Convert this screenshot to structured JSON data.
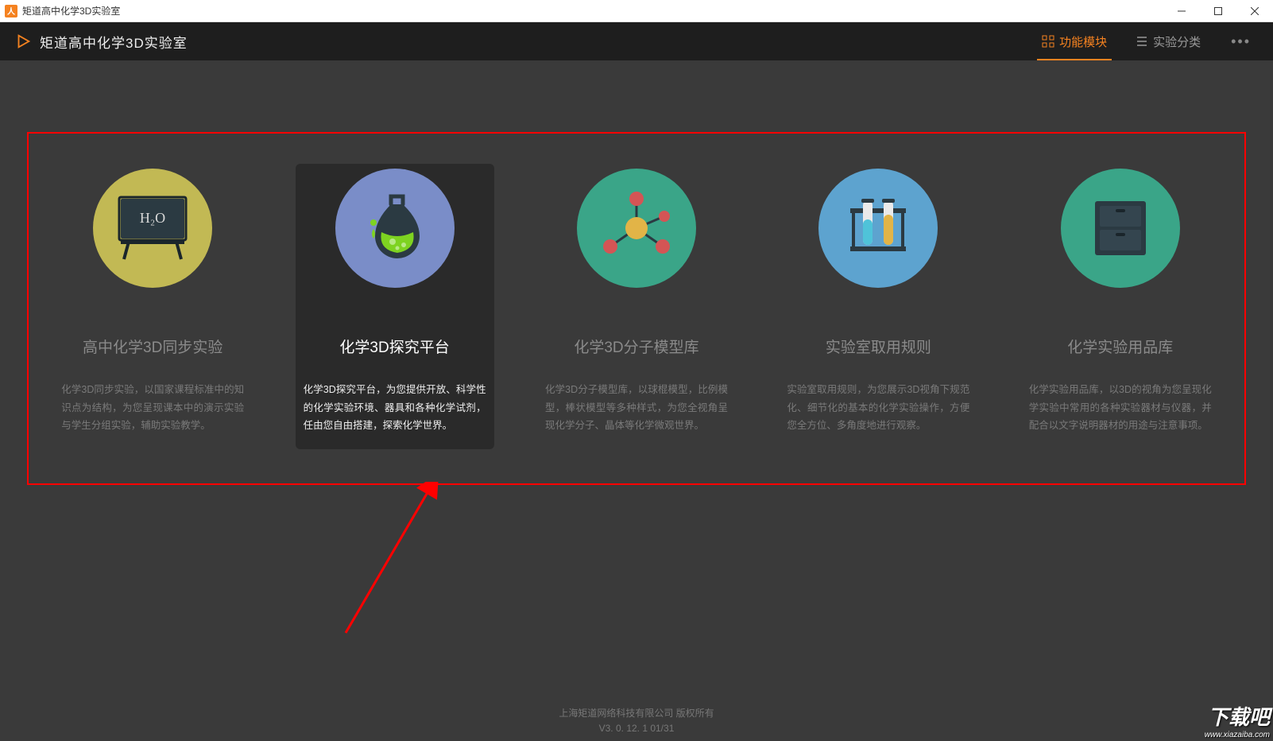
{
  "titlebar": {
    "title": "矩道高中化学3D实验室"
  },
  "header": {
    "app_title": "矩道高中化学3D实验室",
    "nav": {
      "modules": "功能模块",
      "categories": "实验分类"
    }
  },
  "cards": [
    {
      "title": "高中化学3D同步实验",
      "desc": "化学3D同步实验，以国家课程标准中的知识点为结构，为您呈现课本中的演示实验与学生分组实验，辅助实验教学。",
      "icon": "blackboard-icon",
      "icon_label": "H₂O"
    },
    {
      "title": "化学3D探究平台",
      "desc": "化学3D探究平台，为您提供开放、科学性的化学实验环境、器具和各种化学试剂，任由您自由搭建，探索化学世界。",
      "icon": "flask-icon"
    },
    {
      "title": "化学3D分子模型库",
      "desc": "化学3D分子模型库，以球棍模型，比例模型，棒状模型等多种样式，为您全视角呈现化学分子、晶体等化学微观世界。",
      "icon": "molecule-icon"
    },
    {
      "title": "实验室取用规则",
      "desc": "实验室取用规则，为您展示3D视角下规范化、细节化的基本的化学实验操作，方便您全方位、多角度地进行观察。",
      "icon": "test-tubes-icon"
    },
    {
      "title": "化学实验用品库",
      "desc": "化学实验用品库，以3D的视角为您呈现化学实验中常用的各种实验器材与仪器，并配合以文字说明器材的用途与注意事项。",
      "icon": "cabinet-icon"
    }
  ],
  "footer": {
    "copyright": "上海矩道网络科技有限公司  版权所有",
    "version": "V3. 0. 12. 1  01/31"
  },
  "watermark": {
    "big": "下载吧",
    "small": "www.xiazaiba.com"
  }
}
